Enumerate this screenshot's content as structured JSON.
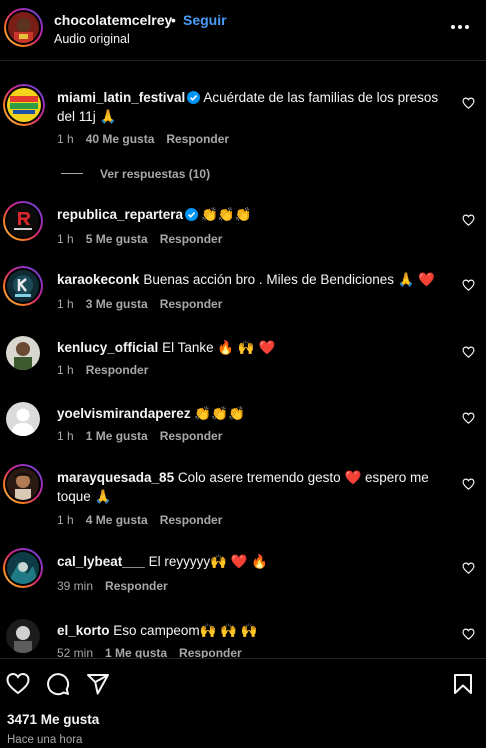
{
  "post": {
    "author": "chocolatemcelrey",
    "separator": "•",
    "follow_label": "Seguir",
    "audio_label": "Audio original",
    "menu_icon": "more-horizontal-icon"
  },
  "comments": [
    {
      "user": "miami_latin_festival",
      "verified": true,
      "text": "Acuérdate de las familias de los presos del 11j 🙏",
      "time": "1 h",
      "likes": "40 Me gusta",
      "reply": "Responder"
    },
    {
      "user": "republica_repartera",
      "verified": true,
      "text": "👏👏👏",
      "time": "1 h",
      "likes": "5 Me gusta",
      "reply": "Responder"
    },
    {
      "user": "karaokeconk",
      "verified": false,
      "text": "Buenas acción bro . Miles de Bendiciones 🙏 ❤️",
      "time": "1 h",
      "likes": "3 Me gusta",
      "reply": "Responder"
    },
    {
      "user": "kenlucy_official",
      "verified": false,
      "text": "El Tanke 🔥 🙌 ❤️",
      "time": "1 h",
      "likes": "",
      "reply": "Responder"
    },
    {
      "user": "yoelvismirandaperez",
      "verified": false,
      "text": "👏👏👏",
      "time": "1 h",
      "likes": "1 Me gusta",
      "reply": "Responder"
    },
    {
      "user": "marayquesada_85",
      "verified": false,
      "text": "Colo asere tremendo gesto ❤️  espero me toque 🙏",
      "time": "1 h",
      "likes": "4 Me gusta",
      "reply": "Responder"
    },
    {
      "user": "cal_lybeat___",
      "verified": false,
      "text": "El reyyyyy🙌 ❤️ 🔥",
      "time": "39 min",
      "likes": "",
      "reply": "Responder"
    },
    {
      "user": "el_korto",
      "verified": false,
      "text": "Eso campeom🙌 🙌 🙌",
      "time": "52 min",
      "likes": "1 Me gusta",
      "reply": "Responder"
    }
  ],
  "view_replies_label": "Ver respuestas (10)",
  "footer": {
    "likes": "3471 Me gusta",
    "time_ago": "Hace una hora",
    "icons": [
      "heart-icon",
      "comment-icon",
      "share-icon",
      "bookmark-icon"
    ]
  },
  "colors": {
    "background": "#000000",
    "text": "#f5f5f5",
    "muted": "#a8a8a8",
    "accent": "#4a9df8",
    "verified": "#0095f6"
  }
}
